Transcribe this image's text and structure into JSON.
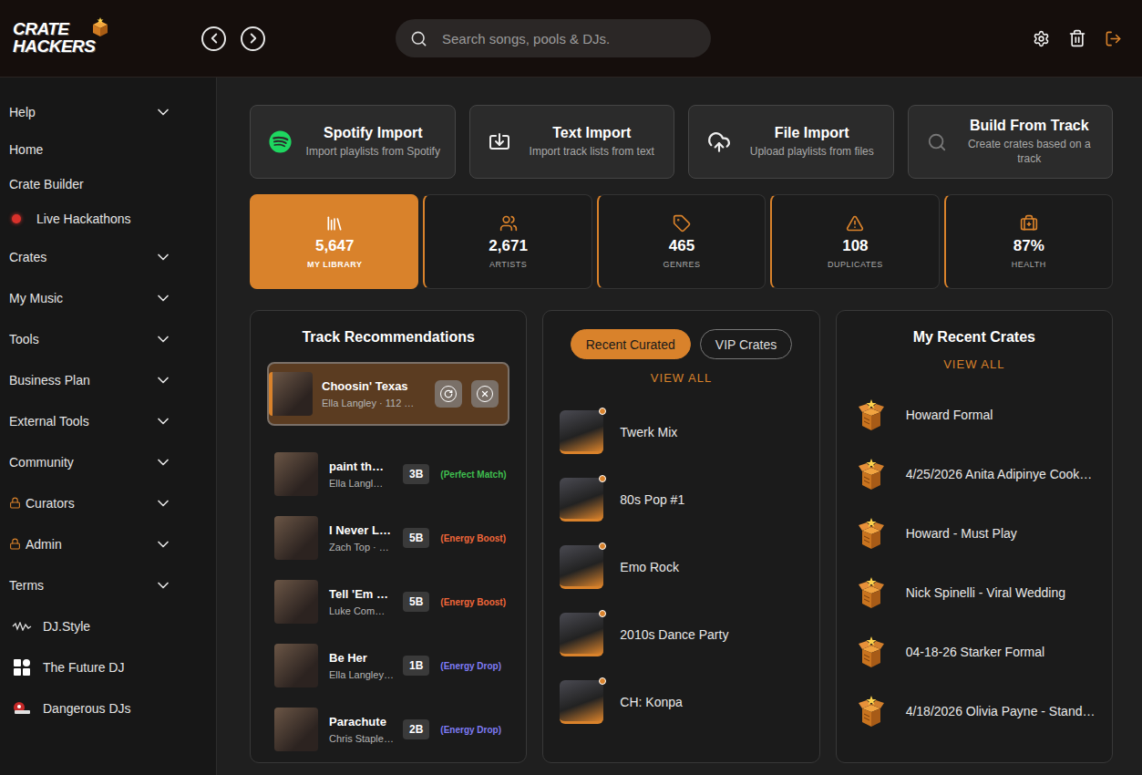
{
  "app": {
    "logo": [
      "CRATE",
      "HACKERS"
    ]
  },
  "header": {
    "search_placeholder": "Search songs, pools & DJs."
  },
  "sidebar": {
    "items": [
      {
        "label": "Help",
        "kind": "group",
        "expanded": false,
        "locked": false
      },
      {
        "label": "Home",
        "kind": "link",
        "expanded": false,
        "locked": false
      },
      {
        "label": "Crate Builder",
        "kind": "link",
        "expanded": false,
        "locked": false
      },
      {
        "label": "Live Hackathons",
        "kind": "live",
        "expanded": false,
        "locked": false
      },
      {
        "label": "Crates",
        "kind": "group",
        "expanded": false,
        "locked": false
      },
      {
        "label": "My Music",
        "kind": "group",
        "expanded": false,
        "locked": false
      },
      {
        "label": "Tools",
        "kind": "group",
        "expanded": false,
        "locked": false
      },
      {
        "label": "Business Plan",
        "kind": "group",
        "expanded": false,
        "locked": false
      },
      {
        "label": "External Tools",
        "kind": "group",
        "expanded": false,
        "locked": false
      },
      {
        "label": "Community",
        "kind": "group",
        "expanded": false,
        "locked": false
      },
      {
        "label": "Curators",
        "kind": "group",
        "expanded": false,
        "locked": true
      },
      {
        "label": "Admin",
        "kind": "group",
        "expanded": false,
        "locked": true
      },
      {
        "label": "Terms",
        "kind": "group",
        "expanded": false,
        "locked": false
      },
      {
        "label": "DJ.Style",
        "kind": "external",
        "expanded": false,
        "locked": false
      },
      {
        "label": "The Future DJ",
        "kind": "external",
        "expanded": false,
        "locked": false
      },
      {
        "label": "Dangerous DJs",
        "kind": "external",
        "expanded": false,
        "locked": false
      }
    ]
  },
  "imports": [
    {
      "title": "Spotify Import",
      "subtitle": "Import playlists from Spotify"
    },
    {
      "title": "Text Import",
      "subtitle": "Import track lists from text"
    },
    {
      "title": "File Import",
      "subtitle": "Upload playlists from files"
    },
    {
      "title": "Build From Track",
      "subtitle": "Create crates based on a track"
    }
  ],
  "stats": [
    {
      "value": "5,647",
      "label": "MY LIBRARY",
      "selected": true
    },
    {
      "value": "2,671",
      "label": "ARTISTS",
      "selected": false
    },
    {
      "value": "465",
      "label": "GENRES",
      "selected": false
    },
    {
      "value": "108",
      "label": "DUPLICATES",
      "selected": false
    },
    {
      "value": "87%",
      "label": "HEALTH",
      "selected": false
    }
  ],
  "recommendations": {
    "title": "Track Recommendations",
    "current": {
      "title": "Choosin' Texas",
      "subtitle": "Ella Langley · 112 …"
    },
    "tracks": [
      {
        "title": "paint th…",
        "artist": "Ella Langl…",
        "key": "3B",
        "match": "(Perfect Match)",
        "color": "#3fbf4f"
      },
      {
        "title": "I Never L…",
        "artist": "Zach Top · …",
        "key": "5B",
        "match": "(Energy Boost)",
        "color": "#f0673a"
      },
      {
        "title": "Tell 'Em …",
        "artist": "Luke Com…",
        "key": "5B",
        "match": "(Energy Boost)",
        "color": "#f0673a"
      },
      {
        "title": "Be Her",
        "artist": "Ella Langley…",
        "key": "1B",
        "match": "(Energy Drop)",
        "color": "#7f7cf5"
      },
      {
        "title": "Parachute",
        "artist": "Chris Staple…",
        "key": "2B",
        "match": "(Energy Drop)",
        "color": "#7f7cf5"
      }
    ]
  },
  "curated": {
    "tabs": [
      {
        "label": "Recent Curated",
        "selected": true
      },
      {
        "label": "VIP Crates",
        "selected": false
      }
    ],
    "view_all": "VIEW ALL",
    "items": [
      {
        "name": "Twerk Mix"
      },
      {
        "name": "80s Pop #1"
      },
      {
        "name": "Emo Rock"
      },
      {
        "name": "2010s Dance Party"
      },
      {
        "name": "CH: Konpa"
      }
    ]
  },
  "recent_crates": {
    "title": "My Recent Crates",
    "view_all": "VIEW ALL",
    "items": [
      {
        "name": "Howard Formal"
      },
      {
        "name": "4/25/2026 Anita Adipinye Cook…"
      },
      {
        "name": "Howard - Must Play"
      },
      {
        "name": "Nick Spinelli - Viral Wedding"
      },
      {
        "name": "04-18-26 Starker Formal"
      },
      {
        "name": "4/18/2026 Olivia Payne - Stand…"
      }
    ]
  }
}
